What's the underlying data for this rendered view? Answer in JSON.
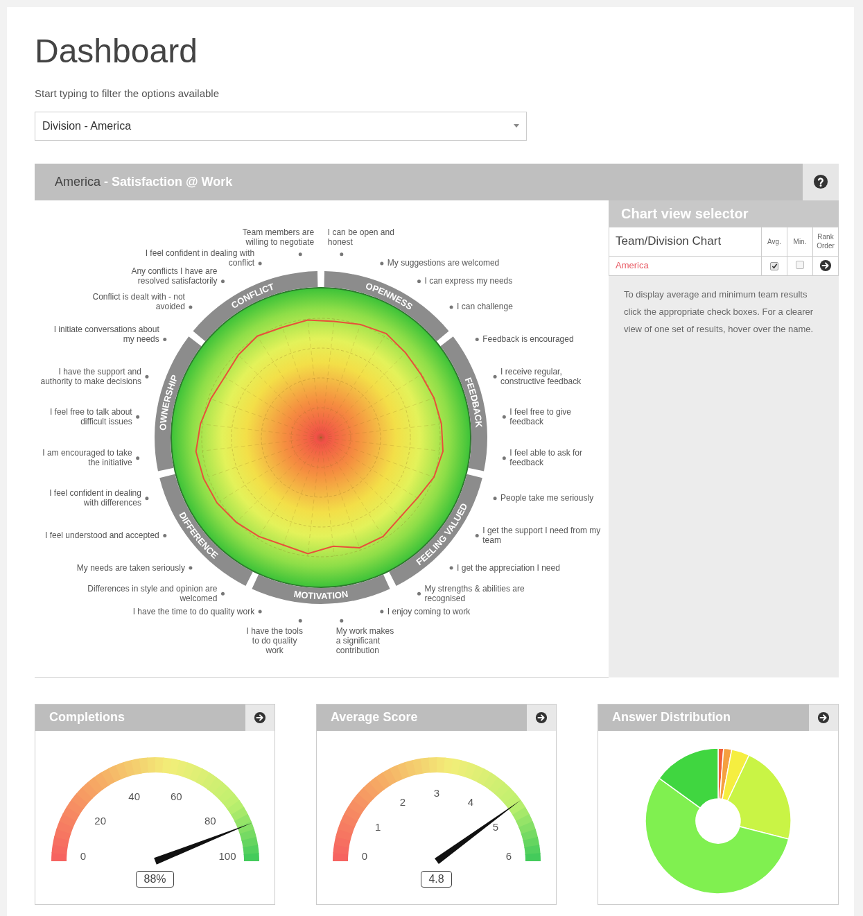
{
  "page": {
    "title": "Dashboard"
  },
  "filter": {
    "label": "Start typing to filter the options available",
    "value": "Division - America"
  },
  "panel": {
    "title": "America",
    "subtitle": "- Satisfaction @ Work"
  },
  "radial_chart": {
    "categories": [
      "CONFLICT",
      "OPENNESS",
      "OWNERSHIP",
      "FEEDBACK",
      "DIFFERENCE",
      "FEELING VALUED",
      "MOTIVATION"
    ],
    "statements": [
      "Team members are willing to negotiate",
      "I can be open and honest",
      "I feel confident in dealing with conflict",
      "My suggestions are welcomed",
      "Any conflicts I have are resolved satisfactorily",
      "I can express my needs",
      "Conflict is dealt with - not avoided",
      "I can challenge",
      "I initiate conversations about my needs",
      "Feedback is encouraged",
      "I have the support and authority to make decisions",
      "I receive regular, constructive feedback",
      "I feel free to talk about difficult issues",
      "I feel free to give feedback",
      "I am encouraged to take the initiative",
      "I feel able to ask for feedback",
      "I feel confident in dealing with differences",
      "People take me seriously",
      "I feel understood and accepted",
      "I get the support I need from my team",
      "My needs are taken seriously",
      "I get the appreciation I need",
      "Differences in style and opinion are welcomed",
      "My strengths & abilities are recognised",
      "I have the time to do quality work",
      "I enjoy coming to work",
      "I have the tools to do quality work",
      "My work makes a significant contribution"
    ]
  },
  "chart_view_selector": {
    "title": "Chart view selector",
    "columns": [
      "Team/Division Chart",
      "Avg.",
      "Min.",
      "Rank Order"
    ],
    "rows": [
      {
        "name": "America",
        "avg_checked": true,
        "min_checked": false
      }
    ],
    "help_text": "To display average and minimum team results click the appropriate check boxes. For a clearer view of one set of results, hover over the name."
  },
  "gauges": [
    {
      "title": "Completions",
      "ticks": [
        "0",
        "20",
        "40",
        "60",
        "80",
        "100"
      ],
      "value": "88%",
      "level": 0.88
    },
    {
      "title": "Average Score",
      "ticks": [
        "0",
        "1",
        "2",
        "3",
        "4",
        "5",
        "6"
      ],
      "value": "4.8",
      "level": 0.8
    }
  ],
  "answer_distribution": {
    "title": "Answer Distribution"
  }
}
